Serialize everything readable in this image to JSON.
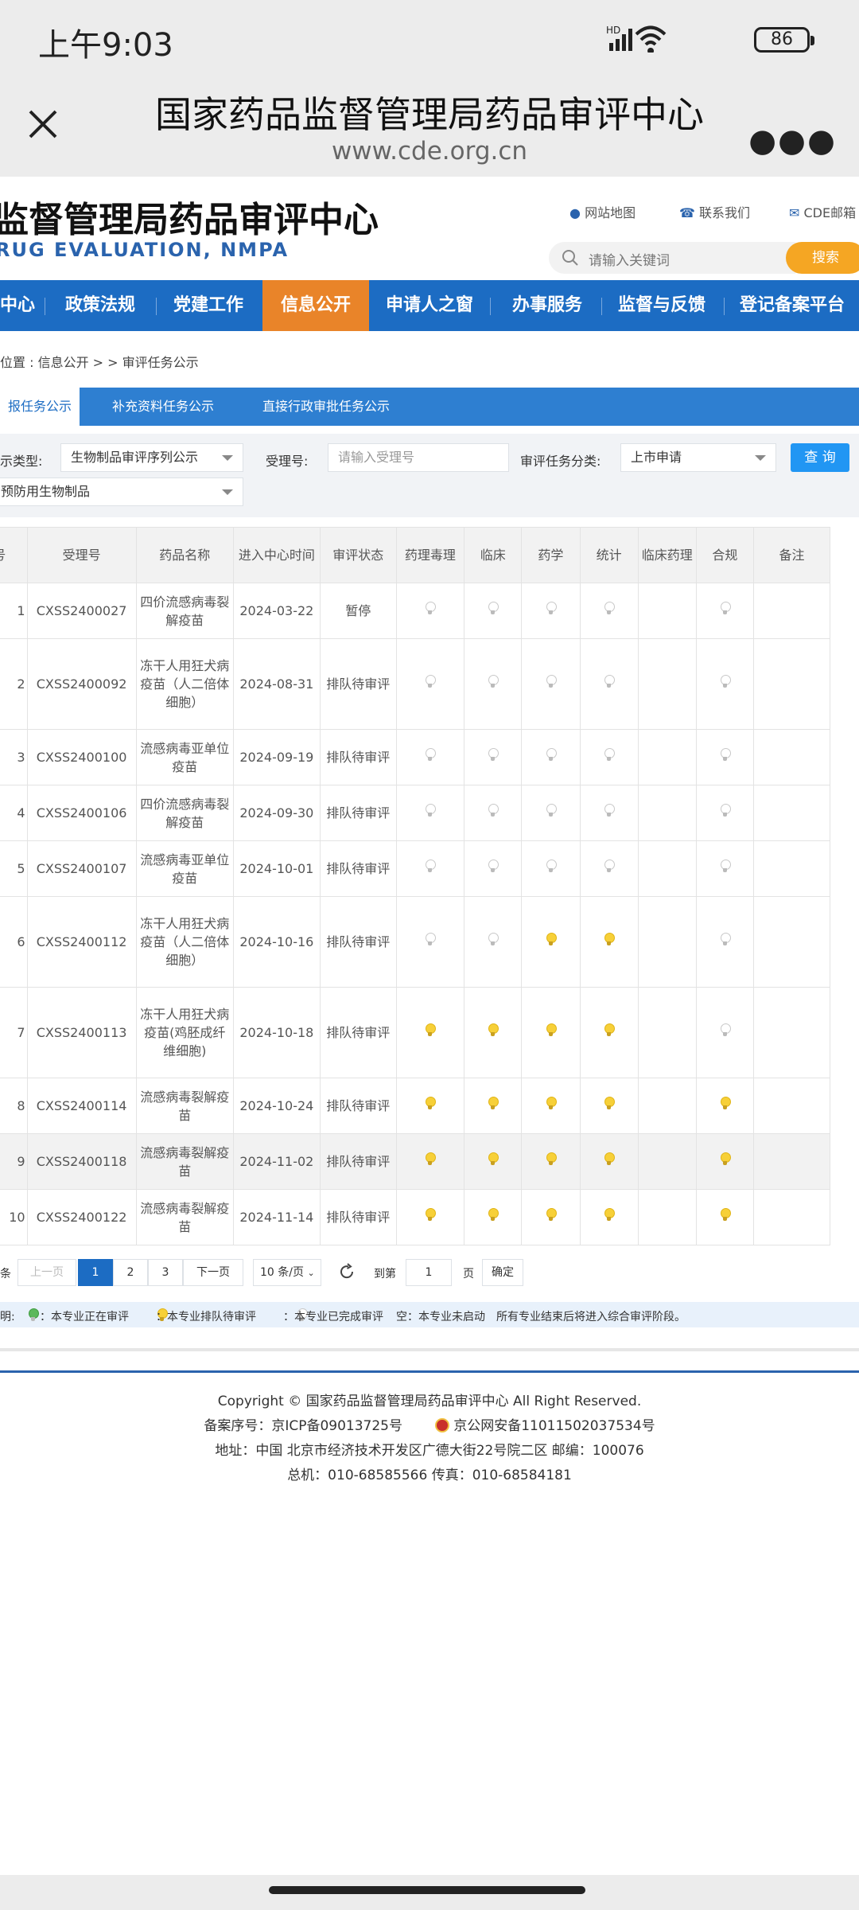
{
  "status_bar": {
    "time": "上午9:03",
    "network": "HD",
    "battery": "86"
  },
  "browser": {
    "title": "国家药品监督管理局药品审评中心",
    "url": "www.cde.org.cn"
  },
  "site": {
    "name_cn": "监督管理局药品审评中心",
    "name_en": "RUG EVALUATION, NMPA",
    "links": [
      "网站地图",
      "联系我们",
      "CDE邮箱"
    ],
    "search_placeholder": "请输入关键词",
    "search_button": "搜索"
  },
  "nav": {
    "items": [
      "中心",
      "政策法规",
      "党建工作",
      "信息公开",
      "申请人之窗",
      "办事服务",
      "监督与反馈",
      "登记备案平台"
    ],
    "active": "信息公开"
  },
  "breadcrumb": "位置 : 信息公开 > > 审评任务公示",
  "tabs": [
    "报任务公示",
    "补充资料任务公示",
    "直接行政审批任务公示"
  ],
  "filter": {
    "type_label": "示类型:",
    "type_value": "生物制品审评序列公示",
    "accept_label": "受理号:",
    "accept_placeholder": "请输入受理号",
    "category_label": "审评任务分类:",
    "category_value": "上市申请",
    "query_button": "查 询",
    "subtype_value": "预防用生物制品"
  },
  "table": {
    "headers": [
      "号",
      "受理号",
      "药品名称",
      "进入中心时间",
      "审评状态",
      "药理毒理",
      "临床",
      "药学",
      "统计",
      "临床药理",
      "合规",
      "备注"
    ],
    "rows": [
      {
        "no": "1",
        "id": "CXSS2400027",
        "name": "四价流感病毒裂解疫苗",
        "date": "2024-03-22",
        "status": "暂停",
        "lights": [
          "gray",
          "gray",
          "gray",
          "gray",
          "",
          "gray"
        ]
      },
      {
        "no": "2",
        "id": "CXSS2400092",
        "name": "冻干人用狂犬病疫苗（人二倍体细胞）",
        "date": "2024-08-31",
        "status": "排队待审评",
        "lights": [
          "gray",
          "gray",
          "gray",
          "gray",
          "",
          "gray"
        ]
      },
      {
        "no": "3",
        "id": "CXSS2400100",
        "name": "流感病毒亚单位疫苗",
        "date": "2024-09-19",
        "status": "排队待审评",
        "lights": [
          "gray",
          "gray",
          "gray",
          "gray",
          "",
          "gray"
        ]
      },
      {
        "no": "4",
        "id": "CXSS2400106",
        "name": "四价流感病毒裂解疫苗",
        "date": "2024-09-30",
        "status": "排队待审评",
        "lights": [
          "gray",
          "gray",
          "gray",
          "gray",
          "",
          "gray"
        ]
      },
      {
        "no": "5",
        "id": "CXSS2400107",
        "name": "流感病毒亚单位疫苗",
        "date": "2024-10-01",
        "status": "排队待审评",
        "lights": [
          "gray",
          "gray",
          "gray",
          "gray",
          "",
          "gray"
        ]
      },
      {
        "no": "6",
        "id": "CXSS2400112",
        "name": "冻干人用狂犬病疫苗（人二倍体细胞）",
        "date": "2024-10-16",
        "status": "排队待审评",
        "lights": [
          "gray",
          "gray",
          "yellow",
          "yellow",
          "",
          "gray"
        ]
      },
      {
        "no": "7",
        "id": "CXSS2400113",
        "name": "冻干人用狂犬病疫苗(鸡胚成纤维细胞)",
        "date": "2024-10-18",
        "status": "排队待审评",
        "lights": [
          "yellow",
          "yellow",
          "yellow",
          "yellow",
          "",
          "gray"
        ]
      },
      {
        "no": "8",
        "id": "CXSS2400114",
        "name": "流感病毒裂解疫苗",
        "date": "2024-10-24",
        "status": "排队待审评",
        "lights": [
          "yellow",
          "yellow",
          "yellow",
          "yellow",
          "",
          "yellow"
        ]
      },
      {
        "no": "9",
        "id": "CXSS2400118",
        "name": "流感病毒裂解疫苗",
        "date": "2024-11-02",
        "status": "排队待审评",
        "lights": [
          "yellow",
          "yellow",
          "yellow",
          "yellow",
          "",
          "yellow"
        ]
      },
      {
        "no": "10",
        "id": "CXSS2400122",
        "name": "流感病毒裂解疫苗",
        "date": "2024-11-14",
        "status": "排队待审评",
        "lights": [
          "yellow",
          "yellow",
          "yellow",
          "yellow",
          "",
          "yellow"
        ]
      }
    ]
  },
  "pagination": {
    "total_suffix": "条",
    "prev": "上一页",
    "pages": [
      "1",
      "2",
      "3"
    ],
    "current": "1",
    "next": "下一页",
    "per_page": "10 条/页",
    "goto_label": "到第",
    "goto_value": "1",
    "page_suffix": "页",
    "confirm": "确定"
  },
  "legend": {
    "prefix": "明:",
    "in_review": "：本专业正在审评",
    "queued": "：本专业排队待审评",
    "done": "：本专业已完成审评",
    "empty": "空：本专业未启动",
    "note": "所有专业结束后将进入综合审评阶段。"
  },
  "footer": {
    "copyright": "Copyright © 国家药品监督管理局药品审评中心  All Right Reserved.",
    "icp": "备案序号：京ICP备09013725号",
    "police": "京公网安备11011502037534号",
    "address": "地址：中国 北京市经济技术开发区广德大街22号院二区      邮编：100076",
    "phone": "总机：010-68585566      传真：010-68584181"
  }
}
